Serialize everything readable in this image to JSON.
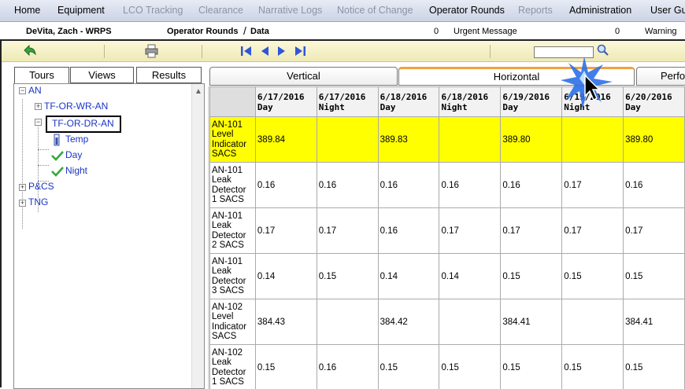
{
  "menu": [
    {
      "label": "Home",
      "enabled": true
    },
    {
      "label": "Equipment",
      "enabled": true
    },
    {
      "label": "LCO Tracking",
      "enabled": false
    },
    {
      "label": "Clearance",
      "enabled": false
    },
    {
      "label": "Narrative Logs",
      "enabled": false
    },
    {
      "label": "Notice of Change",
      "enabled": false
    },
    {
      "label": "Operator Rounds",
      "enabled": true
    },
    {
      "label": "Reports",
      "enabled": false
    },
    {
      "label": "Administration",
      "enabled": true
    },
    {
      "label": "User Gui",
      "enabled": true
    }
  ],
  "info": {
    "user": "DeVita, Zach - WRPS",
    "module": "Operator Rounds",
    "module_sep": "/",
    "section": "Data",
    "urgent_count": "0",
    "urgent_label": "Urgent Message",
    "warning_count": "0",
    "warning_label": "Warning"
  },
  "toolbar": {
    "back_icon": "back-arrow-icon",
    "print_icon": "print-icon",
    "nav_icons": [
      "first-record-icon",
      "previous-record-icon",
      "next-record-icon",
      "last-record-icon"
    ],
    "search_value": "",
    "search_icon": "magnifier-icon"
  },
  "left_tabs": [
    "Tours",
    "Views",
    "Results"
  ],
  "tree": {
    "root": "AN",
    "child_wr": "TF-OR-WR-AN",
    "child_dr": "TF-OR-DR-AN",
    "leaf_temp": "Temp",
    "leaf_day": "Day",
    "leaf_night": "Night",
    "pcs": "P&CS",
    "tng": "TNG"
  },
  "right_tabs": [
    "Vertical",
    "Horizontal",
    "Perfo"
  ],
  "grid": {
    "columns": [
      {
        "date": "6/17/2016",
        "shift": "Day"
      },
      {
        "date": "6/17/2016",
        "shift": "Night"
      },
      {
        "date": "6/18/2016",
        "shift": "Day"
      },
      {
        "date": "6/18/2016",
        "shift": "Night"
      },
      {
        "date": "6/19/2016",
        "shift": "Day"
      },
      {
        "date": "6/19/2016",
        "shift": "Night"
      },
      {
        "date": "6/20/2016",
        "shift": "Day"
      }
    ],
    "rows": [
      {
        "label": "AN-101 Level Indicator SACS",
        "highlight": true,
        "values": [
          "389.84",
          "",
          "389.83",
          "",
          "389.80",
          "",
          "389.80"
        ]
      },
      {
        "label": "AN-101 Leak Detector 1 SACS",
        "highlight": false,
        "values": [
          "0.16",
          "0.16",
          "0.16",
          "0.16",
          "0.16",
          "0.17",
          "0.16"
        ]
      },
      {
        "label": "AN-101 Leak Detector 2 SACS",
        "highlight": false,
        "values": [
          "0.17",
          "0.17",
          "0.16",
          "0.17",
          "0.17",
          "0.17",
          "0.17"
        ]
      },
      {
        "label": "AN-101 Leak Detector 3 SACS",
        "highlight": false,
        "values": [
          "0.14",
          "0.15",
          "0.14",
          "0.14",
          "0.15",
          "0.15",
          "0.15"
        ]
      },
      {
        "label": "AN-102 Level Indicator SACS",
        "highlight": false,
        "values": [
          "384.43",
          "",
          "384.42",
          "",
          "384.41",
          "",
          "384.41"
        ]
      },
      {
        "label": "AN-102 Leak Detector 1 SACS",
        "highlight": false,
        "values": [
          "0.15",
          "0.16",
          "0.15",
          "0.15",
          "0.15",
          "0.15",
          "0.15"
        ]
      }
    ]
  },
  "colors": {
    "highlight_row": "#ffff00",
    "active_tab_accent": "#f1a13c",
    "tree_link": "#1a35c7",
    "toolbar_bg": "#efe9b6"
  }
}
